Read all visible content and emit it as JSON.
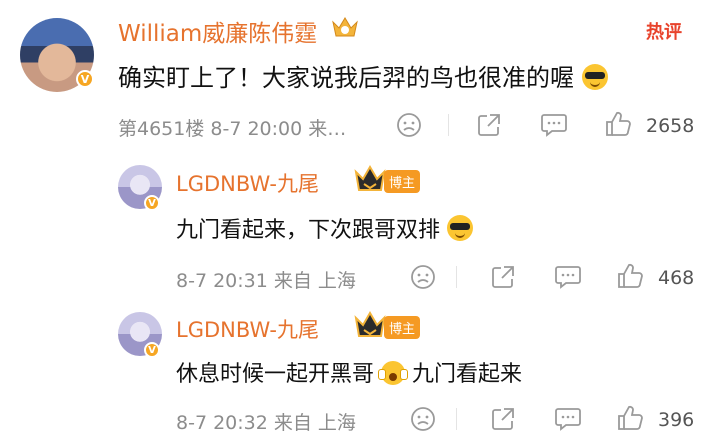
{
  "comment": {
    "username": "William威廉陈伟霆",
    "text": "确实盯上了！大家说我后羿的鸟也很准的喔",
    "meta": "第4651楼  8-7 20:00  来…",
    "like_count": "2658",
    "hot_label": "热评"
  },
  "replies": [
    {
      "username": "LGDNBW-九尾",
      "host_badge": "博主",
      "text": "九门看起来，下次跟哥双排",
      "meta": "8-7 20:31  来自 上海",
      "like_count": "468"
    },
    {
      "username": "LGDNBW-九尾",
      "host_badge": "博主",
      "text_before": "休息时候一起开黑哥",
      "text_after": "九门看起来",
      "meta": "8-7 20:32  来自 上海",
      "like_count": "396"
    }
  ],
  "verified_badge": "V",
  "colors": {
    "username": "#e6732e",
    "hot": "#e8432c",
    "meta": "#8c8c8c",
    "icon": "#9a9a9a",
    "host_badge": "#f59a23"
  },
  "icons": [
    "dislike-icon",
    "share-icon",
    "comment-icon",
    "like-icon",
    "crown-icon"
  ]
}
